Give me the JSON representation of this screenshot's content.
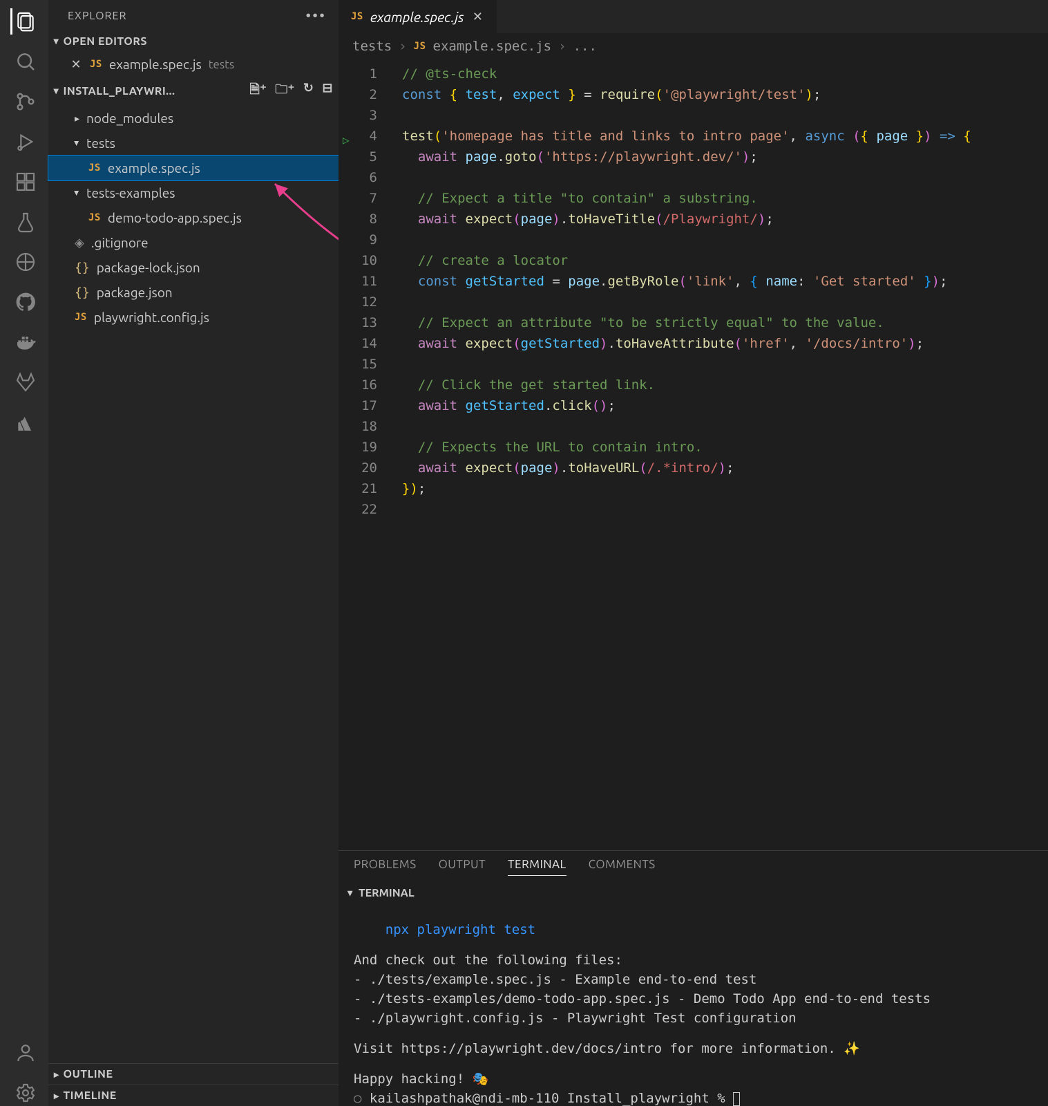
{
  "activityBar": {
    "items": [
      "explorer",
      "search",
      "source-control",
      "run",
      "testing",
      "extensions",
      "beaker",
      "live-share",
      "github",
      "docker",
      "gitlab",
      "atlassian"
    ],
    "bottom": [
      "account",
      "settings"
    ],
    "active": 0
  },
  "sidebar": {
    "title": "EXPLORER",
    "openEditors": {
      "label": "OPEN EDITORS",
      "items": [
        {
          "icon": "js",
          "name": "example.spec.js",
          "dir": "tests"
        }
      ]
    },
    "project": {
      "label": "INSTALL_PLAYWRI...",
      "actions": [
        "new-file",
        "new-folder",
        "refresh",
        "collapse-all"
      ]
    },
    "tree": [
      {
        "type": "folder",
        "open": false,
        "indent": 1,
        "name": "node_modules"
      },
      {
        "type": "folder",
        "open": true,
        "indent": 1,
        "name": "tests"
      },
      {
        "type": "file",
        "indent": 2,
        "icon": "js",
        "name": "example.spec.js",
        "selected": true
      },
      {
        "type": "folder",
        "open": true,
        "indent": 1,
        "name": "tests-examples"
      },
      {
        "type": "file",
        "indent": 2,
        "icon": "js",
        "name": "demo-todo-app.spec.js"
      },
      {
        "type": "file",
        "indent": 1,
        "icon": "git",
        "name": ".gitignore"
      },
      {
        "type": "file",
        "indent": 1,
        "icon": "json",
        "name": "package-lock.json"
      },
      {
        "type": "file",
        "indent": 1,
        "icon": "json",
        "name": "package.json"
      },
      {
        "type": "file",
        "indent": 1,
        "icon": "js",
        "name": "playwright.config.js"
      }
    ],
    "bottom": [
      {
        "label": "OUTLINE"
      },
      {
        "label": "TIMELINE"
      }
    ]
  },
  "editor": {
    "tab": {
      "icon": "js",
      "name": "example.spec.js"
    },
    "breadcrumb": {
      "folder": "tests",
      "file": "example.spec.js",
      "symbol": "..."
    },
    "playLine": 4,
    "code": [
      [
        [
          "cmt",
          "// @ts-check"
        ]
      ],
      [
        [
          "kw",
          "const"
        ],
        [
          "pn",
          " "
        ],
        [
          "y",
          "{"
        ],
        [
          "pn",
          " "
        ],
        [
          "const",
          "test"
        ],
        [
          "pn",
          ", "
        ],
        [
          "const",
          "expect"
        ],
        [
          "pn",
          " "
        ],
        [
          "y",
          "}"
        ],
        [
          "pn",
          " = "
        ],
        [
          "fn",
          "require"
        ],
        [
          "y",
          "("
        ],
        [
          "str",
          "'@playwright/test'"
        ],
        [
          "y",
          ")"
        ],
        [
          "pn",
          ";"
        ]
      ],
      [],
      [
        [
          "fn",
          "test"
        ],
        [
          "y",
          "("
        ],
        [
          "str",
          "'homepage has title and links to intro page'"
        ],
        [
          "pn",
          ", "
        ],
        [
          "kw",
          "async"
        ],
        [
          "pn",
          " "
        ],
        [
          "p",
          "("
        ],
        [
          "y",
          "{"
        ],
        [
          "pn",
          " "
        ],
        [
          "var",
          "page"
        ],
        [
          "pn",
          " "
        ],
        [
          "y",
          "}"
        ],
        [
          "p",
          ")"
        ],
        [
          "pn",
          " "
        ],
        [
          "kw",
          "=>"
        ],
        [
          "pn",
          " "
        ],
        [
          "y",
          "{"
        ]
      ],
      [
        [
          "pn",
          "  "
        ],
        [
          "kw2",
          "await"
        ],
        [
          "pn",
          " "
        ],
        [
          "var",
          "page"
        ],
        [
          "pn",
          "."
        ],
        [
          "fn",
          "goto"
        ],
        [
          "p",
          "("
        ],
        [
          "str",
          "'https://playwright.dev/'"
        ],
        [
          "p",
          ")"
        ],
        [
          "pn",
          ";"
        ]
      ],
      [],
      [
        [
          "pn",
          "  "
        ],
        [
          "cmt",
          "// Expect a title \"to contain\" a substring."
        ]
      ],
      [
        [
          "pn",
          "  "
        ],
        [
          "kw2",
          "await"
        ],
        [
          "pn",
          " "
        ],
        [
          "fn",
          "expect"
        ],
        [
          "p",
          "("
        ],
        [
          "var",
          "page"
        ],
        [
          "p",
          ")"
        ],
        [
          "pn",
          "."
        ],
        [
          "fn",
          "toHaveTitle"
        ],
        [
          "p",
          "("
        ],
        [
          "re",
          "/Playwright/"
        ],
        [
          "p",
          ")"
        ],
        [
          "pn",
          ";"
        ]
      ],
      [],
      [
        [
          "pn",
          "  "
        ],
        [
          "cmt",
          "// create a locator"
        ]
      ],
      [
        [
          "pn",
          "  "
        ],
        [
          "kw",
          "const"
        ],
        [
          "pn",
          " "
        ],
        [
          "const",
          "getStarted"
        ],
        [
          "pn",
          " = "
        ],
        [
          "var",
          "page"
        ],
        [
          "pn",
          "."
        ],
        [
          "fn",
          "getByRole"
        ],
        [
          "p",
          "("
        ],
        [
          "str",
          "'link'"
        ],
        [
          "pn",
          ", "
        ],
        [
          "b",
          "{"
        ],
        [
          "pn",
          " "
        ],
        [
          "var",
          "name"
        ],
        [
          "pn",
          ": "
        ],
        [
          "str",
          "'Get started'"
        ],
        [
          "pn",
          " "
        ],
        [
          "b",
          "}"
        ],
        [
          "p",
          ")"
        ],
        [
          "pn",
          ";"
        ]
      ],
      [],
      [
        [
          "pn",
          "  "
        ],
        [
          "cmt",
          "// Expect an attribute \"to be strictly equal\" to the value."
        ]
      ],
      [
        [
          "pn",
          "  "
        ],
        [
          "kw2",
          "await"
        ],
        [
          "pn",
          " "
        ],
        [
          "fn",
          "expect"
        ],
        [
          "p",
          "("
        ],
        [
          "const",
          "getStarted"
        ],
        [
          "p",
          ")"
        ],
        [
          "pn",
          "."
        ],
        [
          "fn",
          "toHaveAttribute"
        ],
        [
          "p",
          "("
        ],
        [
          "str",
          "'href'"
        ],
        [
          "pn",
          ", "
        ],
        [
          "str",
          "'/docs/intro'"
        ],
        [
          "p",
          ")"
        ],
        [
          "pn",
          ";"
        ]
      ],
      [],
      [
        [
          "pn",
          "  "
        ],
        [
          "cmt",
          "// Click the get started link."
        ]
      ],
      [
        [
          "pn",
          "  "
        ],
        [
          "kw2",
          "await"
        ],
        [
          "pn",
          " "
        ],
        [
          "const",
          "getStarted"
        ],
        [
          "pn",
          "."
        ],
        [
          "fn",
          "click"
        ],
        [
          "p",
          "("
        ],
        [
          "p",
          ")"
        ],
        [
          "pn",
          ";"
        ]
      ],
      [],
      [
        [
          "pn",
          "  "
        ],
        [
          "cmt",
          "// Expects the URL to contain intro."
        ]
      ],
      [
        [
          "pn",
          "  "
        ],
        [
          "kw2",
          "await"
        ],
        [
          "pn",
          " "
        ],
        [
          "fn",
          "expect"
        ],
        [
          "p",
          "("
        ],
        [
          "var",
          "page"
        ],
        [
          "p",
          ")"
        ],
        [
          "pn",
          "."
        ],
        [
          "fn",
          "toHaveURL"
        ],
        [
          "p",
          "("
        ],
        [
          "re",
          "/.*intro/"
        ],
        [
          "p",
          ")"
        ],
        [
          "pn",
          ";"
        ]
      ],
      [
        [
          "y",
          "}"
        ],
        [
          "y",
          ")"
        ],
        [
          "pn",
          ";"
        ]
      ],
      []
    ]
  },
  "panel": {
    "tabs": [
      "PROBLEMS",
      "OUTPUT",
      "TERMINAL",
      "COMMENTS"
    ],
    "active": 2,
    "subHeader": "TERMINAL",
    "terminal": {
      "command": "npx playwright test",
      "intro": "And check out the following files:",
      "files": [
        "./tests/example.spec.js - Example end-to-end test",
        "./tests-examples/demo-todo-app.spec.js - Demo Todo App end-to-end tests",
        "./playwright.config.js - Playwright Test configuration"
      ],
      "visit": "Visit https://playwright.dev/docs/intro for more information. ✨",
      "happy": "Happy hacking! 🎭",
      "prompt": "kailashpathak@ndi-mb-110 Install_playwright % "
    }
  }
}
